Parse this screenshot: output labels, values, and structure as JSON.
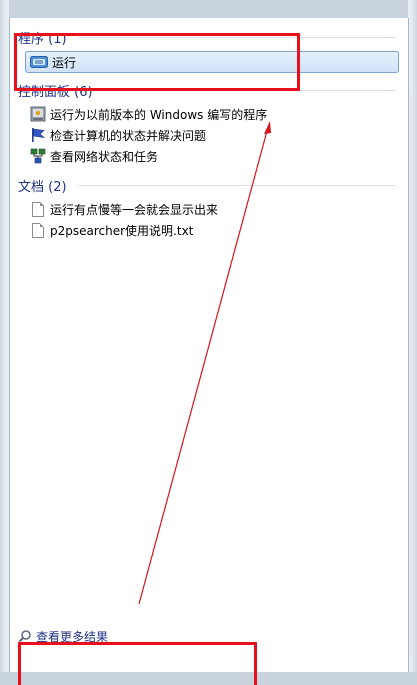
{
  "groups": {
    "programs": {
      "header": "程序 (1)",
      "items": [
        {
          "label": "运行",
          "icon": "run-icon"
        }
      ]
    },
    "control_panel": {
      "header": "控制面板 (6)",
      "items": [
        {
          "label": "运行为以前版本的 Windows 编写的程序",
          "icon": "compatibility-icon"
        },
        {
          "label": "检查计算机的状态并解决问题",
          "icon": "action-center-flag-icon"
        },
        {
          "label": "查看网络状态和任务",
          "icon": "network-icon"
        }
      ]
    },
    "documents": {
      "header": "文档 (2)",
      "items": [
        {
          "label": "运行有点慢等一会就会显示出来",
          "icon": "document-icon"
        },
        {
          "label": "p2psearcher使用说明.txt",
          "icon": "document-icon"
        }
      ]
    }
  },
  "footer": {
    "more_results": "查看更多结果",
    "icon": "search-icon"
  },
  "colors": {
    "highlight": "#e8101c",
    "header_text": "#1e3287",
    "selection_border": "#7da2ce"
  }
}
